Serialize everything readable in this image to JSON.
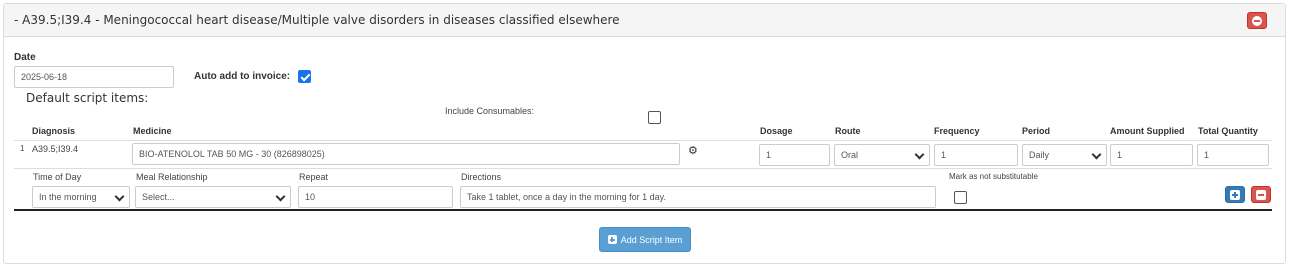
{
  "panel": {
    "title": "- A39.5;I39.4 - Meningococcal heart disease/Multiple valve disorders in diseases classified elsewhere"
  },
  "form": {
    "date_label": "Date",
    "date_value": "2025-06-18",
    "auto_add_label": "Auto add to invoice:",
    "auto_add_checked": true,
    "default_items_label": "Default script items:",
    "include_consumables_label": "Include Consumables:",
    "include_consumables_checked": false
  },
  "table": {
    "headers": {
      "diagnosis": "Diagnosis",
      "medicine": "Medicine",
      "dosage": "Dosage",
      "route": "Route",
      "frequency": "Frequency",
      "period": "Period",
      "amount_supplied": "Amount Supplied",
      "total_quantity": "Total Quantity"
    },
    "row": {
      "index": "1",
      "diagnosis": "A39.5;I39.4",
      "medicine": "BIO-ATENOLOL TAB 50 MG - 30 (826898025)",
      "dosage": "1",
      "route": "Oral",
      "frequency": "1",
      "period": "Daily",
      "amount_supplied": "1",
      "total_quantity": "1"
    },
    "sub_headers": {
      "time_of_day": "Time of Day",
      "meal_relationship": "Meal Relationship",
      "repeat": "Repeat",
      "directions": "Directions",
      "not_substitutable": "Mark as not substitutable"
    },
    "sub_row": {
      "time_of_day": "In the morning",
      "meal_relationship": "Select...",
      "repeat": "10",
      "directions": "Take 1 tablet, once a day in the morning for 1 day.",
      "not_substitutable_checked": false
    }
  },
  "actions": {
    "add_script_item": "Add Script Item"
  },
  "colors": {
    "danger": "#d9534f",
    "primary": "#337ab7",
    "add_button": "#5a9fd4",
    "checkbox_checked": "#1a73e8"
  },
  "icons": {
    "remove_panel": "minus-circle-icon",
    "settings": "gears-icon",
    "add_row": "plus-square-icon",
    "remove_row": "minus-square-icon"
  }
}
